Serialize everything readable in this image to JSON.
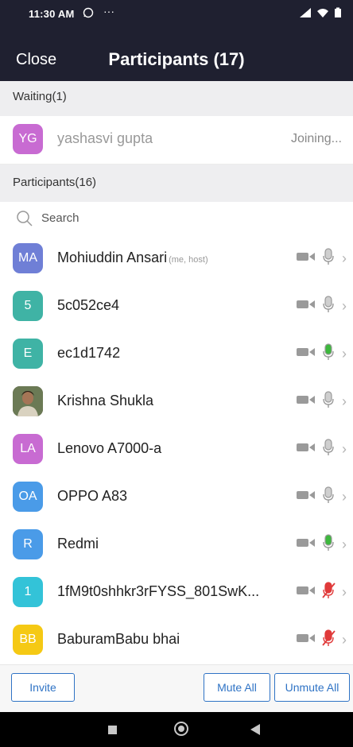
{
  "status_bar": {
    "time": "11:30 AM"
  },
  "header": {
    "close_label": "Close",
    "title": "Participants (17)"
  },
  "waiting_section": {
    "heading": "Waiting(1)",
    "items": [
      {
        "initials": "YG",
        "name": "yashasvi gupta",
        "status": "Joining...",
        "color": "#c86bd2"
      }
    ]
  },
  "participants_section": {
    "heading": "Participants(16)"
  },
  "search": {
    "placeholder": "Search"
  },
  "participants": [
    {
      "initials": "MA",
      "name": "Mohiuddin Ansari",
      "tag": "(me, host)",
      "color": "#6f7fd6",
      "mic": "off-gray"
    },
    {
      "initials": "5",
      "name": "5c052ce4",
      "tag": "",
      "color": "#3fb3a5",
      "mic": "off-gray"
    },
    {
      "initials": "E",
      "name": "ec1d1742",
      "tag": "",
      "color": "#3fb3a5",
      "mic": "active-green"
    },
    {
      "initials": "",
      "name": "Krishna Shukla",
      "tag": "",
      "color": "#5a4a3e",
      "mic": "off-gray",
      "photo": true
    },
    {
      "initials": "LA",
      "name": "Lenovo A7000-a",
      "tag": "",
      "color": "#c86bd2",
      "mic": "off-gray"
    },
    {
      "initials": "OA",
      "name": "OPPO A83",
      "tag": "",
      "color": "#4a9be8",
      "mic": "off-gray"
    },
    {
      "initials": "R",
      "name": "Redmi",
      "tag": "",
      "color": "#4a9be8",
      "mic": "active-green"
    },
    {
      "initials": "1",
      "name": "1fM9t0shhkr3rFYSS_801SwK...",
      "tag": "",
      "color": "#33c3d8",
      "mic": "muted-red"
    },
    {
      "initials": "BB",
      "name": "BaburamBabu bhai",
      "tag": "",
      "color": "#f5c914",
      "mic": "muted-red"
    }
  ],
  "footer": {
    "invite_label": "Invite",
    "mute_all_label": "Mute All",
    "unmute_all_label": "Unmute All"
  },
  "colors": {
    "header_bg": "#1f2030",
    "accent": "#2f73c5",
    "mic_green": "#3db83d",
    "mic_red": "#e03a3a"
  }
}
